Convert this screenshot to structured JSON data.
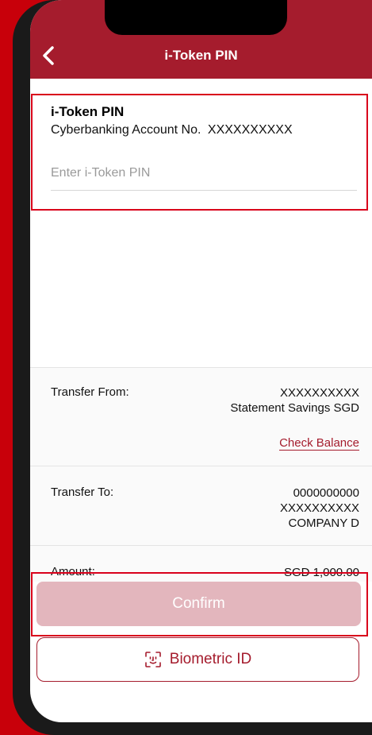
{
  "header": {
    "title": "i-Token PIN",
    "back_icon": "chevron-left-icon"
  },
  "pin_section": {
    "title": "i-Token PIN",
    "account_label": "Cyberbanking Account No.",
    "account_value": "XXXXXXXXXX",
    "input_placeholder": "Enter i-Token PIN",
    "input_value": ""
  },
  "transfer_from": {
    "label": "Transfer From:",
    "account": "XXXXXXXXXX",
    "account_name": "Statement Savings SGD",
    "check_balance": "Check Balance"
  },
  "transfer_to": {
    "label": "Transfer To:",
    "line1": "0000000000",
    "line2": "XXXXXXXXXX",
    "line3": "COMPANY D"
  },
  "amount": {
    "label": "Amount:",
    "value": "SGD 1,000.00"
  },
  "actions": {
    "confirm_label": "Confirm",
    "biometric_label": "Biometric ID",
    "biometric_icon": "face-id-icon"
  },
  "colors": {
    "background_red": "#c8000a",
    "brand_red": "#a51c2d",
    "highlight_red": "#d9001b",
    "confirm_disabled": "#e3b6bd"
  }
}
